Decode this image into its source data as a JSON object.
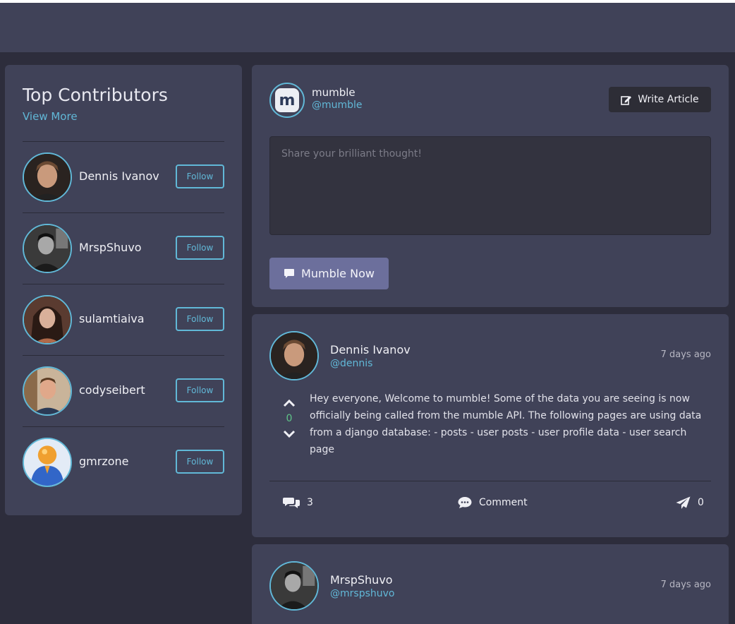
{
  "contributors": {
    "title": "Top Contributors",
    "view_more": "View More",
    "follow_label": "Follow",
    "items": [
      {
        "name": "Dennis Ivanov"
      },
      {
        "name": "MrspShuvo"
      },
      {
        "name": "sulamtiaiva"
      },
      {
        "name": "codyseibert"
      },
      {
        "name": "gmrzone"
      }
    ]
  },
  "compose": {
    "logo_letter": "m",
    "name": "mumble",
    "handle": "@mumble",
    "write_article": "Write Article",
    "placeholder": "Share your brilliant thought!",
    "submit": "Mumble Now"
  },
  "posts": [
    {
      "name": "Dennis Ivanov",
      "handle": "@dennis",
      "time": "7 days ago",
      "votes": "0",
      "content": "Hey everyone, Welcome to mumble! Some of the data you are seeing is now officially being called from the mumble API. The following pages are using data from a django database: - posts - user posts - user profile data - user search page",
      "replies": "3",
      "comment_label": "Comment",
      "shares": "0"
    },
    {
      "name": "MrspShuvo",
      "handle": "@mrspshuvo",
      "time": "7 days ago"
    }
  ],
  "colors": {
    "accent": "#61b8d7",
    "card": "#404258",
    "background": "#2d2d3c",
    "button_primary": "#6c6f9c",
    "vote_count": "#5fc489"
  }
}
